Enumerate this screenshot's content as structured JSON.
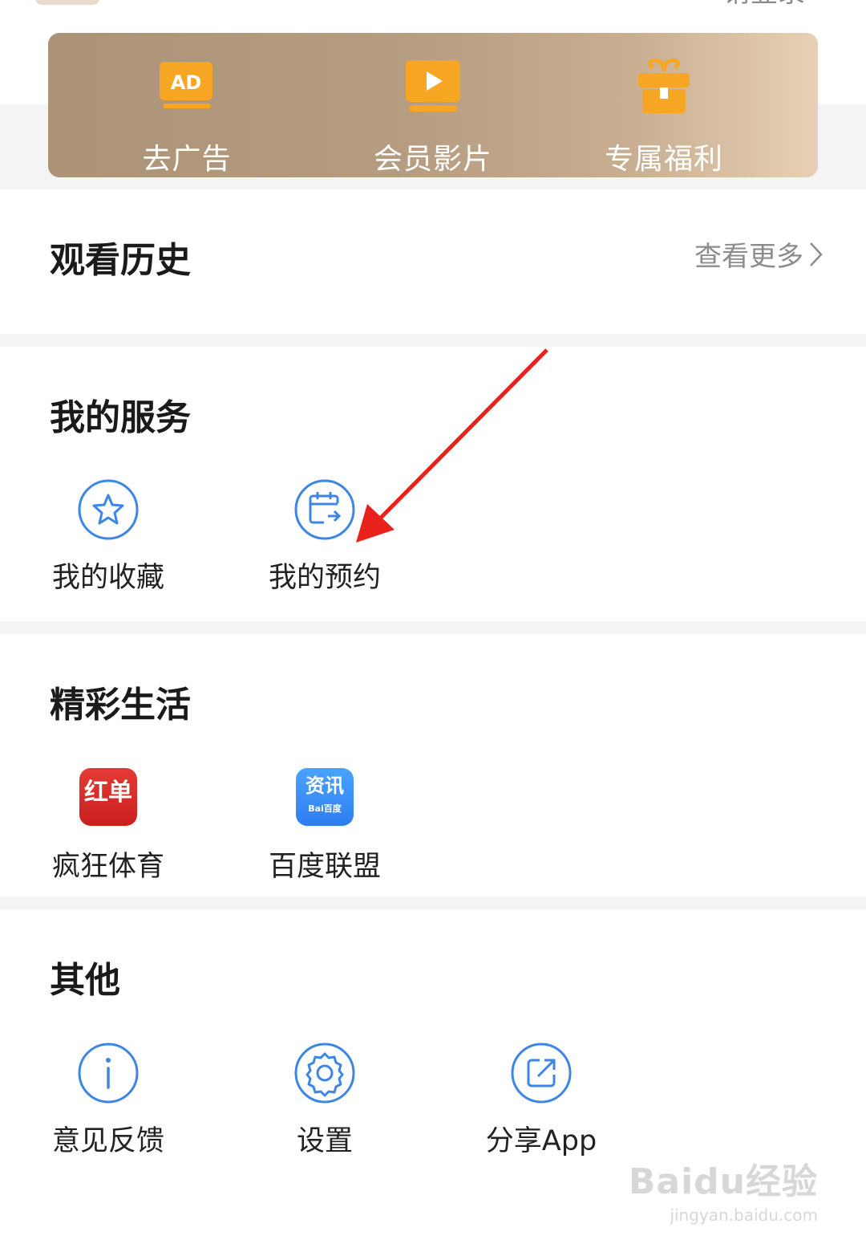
{
  "header": {
    "login_text": "请登录"
  },
  "vip_bar": {
    "items": [
      {
        "label": "去广告",
        "icon": "ad-icon",
        "badge": "AD"
      },
      {
        "label": "会员影片",
        "icon": "play-screen-icon"
      },
      {
        "label": "专属福利",
        "icon": "gift-icon"
      }
    ]
  },
  "history": {
    "title": "观看历史",
    "more_label": "查看更多"
  },
  "services": {
    "title": "我的服务",
    "items": [
      {
        "label": "我的收藏",
        "icon": "star-icon"
      },
      {
        "label": "我的预约",
        "icon": "calendar-icon"
      }
    ]
  },
  "life": {
    "title": "精彩生活",
    "items": [
      {
        "label": "疯狂体育",
        "icon": "hongdan-app-icon",
        "icon_text": "红单"
      },
      {
        "label": "百度联盟",
        "icon": "baidu-news-app-icon",
        "icon_text": "资讯",
        "icon_subtext": "Bai百度"
      }
    ]
  },
  "other": {
    "title": "其他",
    "items": [
      {
        "label": "意见反馈",
        "icon": "info-icon"
      },
      {
        "label": "设置",
        "icon": "settings-gear-icon"
      },
      {
        "label": "分享App",
        "icon": "share-icon"
      }
    ]
  },
  "watermark": {
    "main": "Baidu经验",
    "sub": "jingyan.baidu.com"
  },
  "colors": {
    "accent_blue": "#3d86e6",
    "annotation_red": "#e8221b",
    "vip_orange": "#f6a623"
  }
}
